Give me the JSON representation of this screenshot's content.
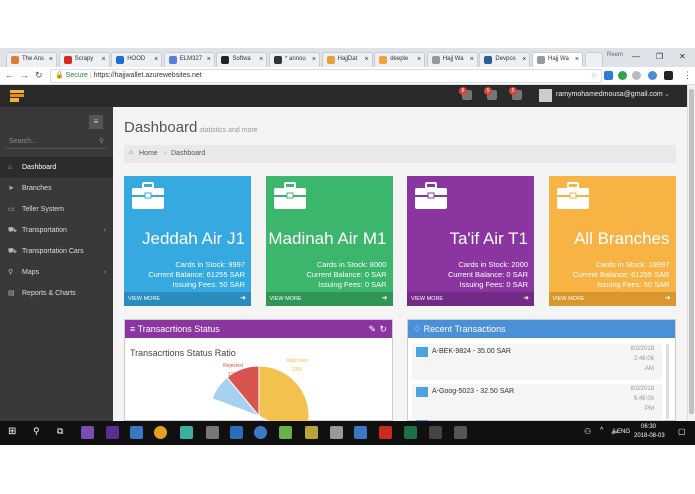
{
  "browser": {
    "tabs": [
      {
        "label": "The Ans",
        "color": "#e07b2f"
      },
      {
        "label": "Scrapy",
        "color": "#d62d20"
      },
      {
        "label": "HOOD",
        "color": "#1c6ed6"
      },
      {
        "label": "ELM327",
        "color": "#5b7fd6"
      },
      {
        "label": "Softwa",
        "color": "#222222"
      },
      {
        "label": "* annou",
        "color": "#333333"
      },
      {
        "label": "HajjDat",
        "color": "#e8a13a"
      },
      {
        "label": "deeple",
        "color": "#f0a33c"
      },
      {
        "label": "Hajj Wa",
        "color": "#999999"
      },
      {
        "label": "Devpos",
        "color": "#2a5c9c"
      },
      {
        "label": "Hajj Wa",
        "color": "#999999"
      }
    ],
    "profile_label": "Reem",
    "secure_label": "Secure",
    "url": "https://hajjwallet.azurewebsites.net"
  },
  "header": {
    "user_email": "ramymohamedmousa@gmail.com",
    "badges": [
      "6",
      "5",
      "5"
    ]
  },
  "sidebar": {
    "search_placeholder": "Search...",
    "items": [
      {
        "label": "Dashboard",
        "icon": "home-icon",
        "glyph": "⌂",
        "chevron": ""
      },
      {
        "label": "Branches",
        "icon": "send-icon",
        "glyph": "➤",
        "chevron": ""
      },
      {
        "label": "Teller System",
        "icon": "card-icon",
        "glyph": "▭",
        "chevron": ""
      },
      {
        "label": "Transportation",
        "icon": "car-icon",
        "glyph": "⛟",
        "chevron": "‹"
      },
      {
        "label": "Transportation Cars",
        "icon": "car-icon",
        "glyph": "⛟",
        "chevron": ""
      },
      {
        "label": "Maps",
        "icon": "pin-icon",
        "glyph": "⚲",
        "chevron": "‹"
      },
      {
        "label": "Reports & Charts",
        "icon": "chart-icon",
        "glyph": "▤",
        "chevron": ""
      }
    ]
  },
  "main": {
    "title": "Dashboard",
    "subtitle": "statistics and more",
    "breadcrumb": {
      "home": "Home",
      "current": "Dashboard"
    },
    "cards": [
      {
        "name": "Jeddah Air J1",
        "stock": "Cards in Stock: 9997",
        "balance": "Current Balance: 61255 SAR",
        "fees": "Issuing Fees: 50 SAR",
        "more": "VIEW MORE",
        "color": "#36a9e1",
        "dark": "#2a8cbd"
      },
      {
        "name": "Madinah Air M1",
        "stock": "Cards in Stock: 8000",
        "balance": "Current Balance: 0 SAR",
        "fees": "Issuing Fees: 0 SAR",
        "more": "VIEW MORE",
        "color": "#3cb56d",
        "dark": "#2f9658"
      },
      {
        "name": "Ta'if Air T1",
        "stock": "Cards in Stock: 2000",
        "balance": "Current Balance: 0 SAR",
        "fees": "Issuing Fees: 0 SAR",
        "more": "VIEW MORE",
        "color": "#8a35a0",
        "dark": "#722a86"
      },
      {
        "name": "All Branches",
        "stock": "Cards in Stock: 19997",
        "balance": "Current Balance: 61255 SAR",
        "fees": "Issuing Fees: 50 SAR",
        "more": "VIEW MORE",
        "color": "#f7b444",
        "dark": "#d9982e"
      }
    ],
    "status_panel": {
      "title": "Transacrtions Status",
      "chart_title": "Transacrtions Status Ratio",
      "header_color": "#8a35a0"
    },
    "recent_panel": {
      "title": "Recent Transactions",
      "header_color": "#4a90d9",
      "items": [
        {
          "text": "A-BEK-9824 - 35.00 SAR",
          "date": "8/2/2018",
          "time": "2:46:06",
          "ampm": "AM"
        },
        {
          "text": "A-Goog-5023 - 32.50 SAR",
          "date": "8/2/2018",
          "time": "6:45:00",
          "ampm": "PM"
        }
      ]
    }
  },
  "chart_data": {
    "type": "pie",
    "title": "Transacrtions Status Ratio",
    "labels": [
      "Approved",
      "Rejected"
    ],
    "values": [
      33,
      11
    ],
    "label_text": [
      "33%",
      "11%"
    ],
    "colors": [
      "#f2c14e",
      "#d9534f",
      "#a8d0f0"
    ]
  },
  "taskbar": {
    "lang": "ENG",
    "time": "06:30",
    "date": "2018-08-03"
  }
}
